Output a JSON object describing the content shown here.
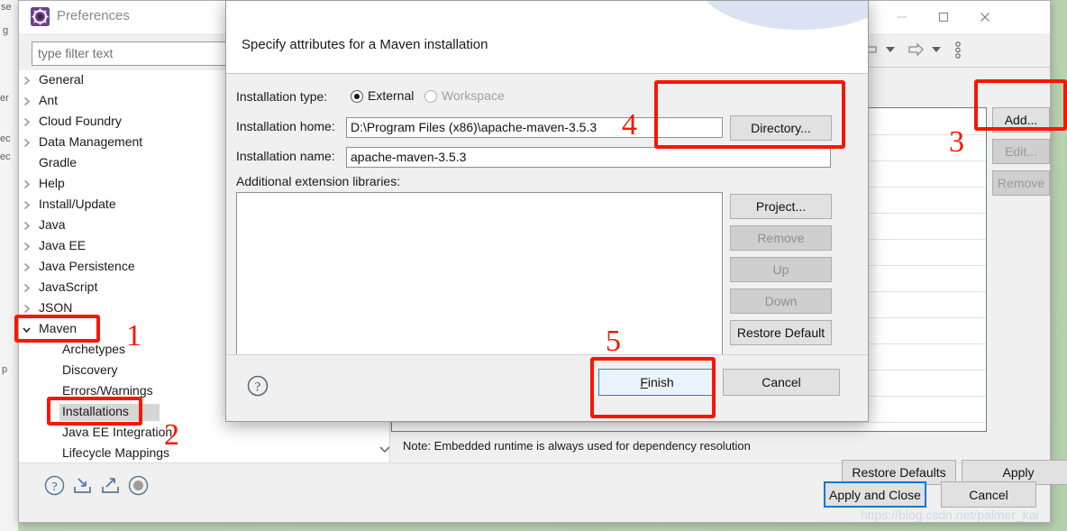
{
  "desktop": {
    "background_fragments": [
      "se",
      "g",
      "er",
      "ec",
      "ec",
      "p"
    ]
  },
  "preferences_window": {
    "title": "Preferences",
    "icon": "eclipse-preferences-icon",
    "window_controls": {
      "minimize": "minimize-icon",
      "maximize": "maximize-icon",
      "close": "close-icon"
    },
    "filter": {
      "placeholder": "type filter text",
      "value": ""
    },
    "tree": [
      {
        "label": "General",
        "indent": 0,
        "arrow": "collapsed",
        "selected": false
      },
      {
        "label": "Ant",
        "indent": 0,
        "arrow": "collapsed",
        "selected": false
      },
      {
        "label": "Cloud Foundry",
        "indent": 0,
        "arrow": "collapsed",
        "selected": false
      },
      {
        "label": "Data Management",
        "indent": 0,
        "arrow": "collapsed",
        "selected": false
      },
      {
        "label": "Gradle",
        "indent": 0,
        "arrow": "none",
        "selected": false
      },
      {
        "label": "Help",
        "indent": 0,
        "arrow": "collapsed",
        "selected": false
      },
      {
        "label": "Install/Update",
        "indent": 0,
        "arrow": "collapsed",
        "selected": false
      },
      {
        "label": "Java",
        "indent": 0,
        "arrow": "collapsed",
        "selected": false
      },
      {
        "label": "Java EE",
        "indent": 0,
        "arrow": "collapsed",
        "selected": false
      },
      {
        "label": "Java Persistence",
        "indent": 0,
        "arrow": "collapsed",
        "selected": false
      },
      {
        "label": "JavaScript",
        "indent": 0,
        "arrow": "collapsed",
        "selected": false
      },
      {
        "label": "JSON",
        "indent": 0,
        "arrow": "collapsed",
        "selected": false
      },
      {
        "label": "Maven",
        "indent": 0,
        "arrow": "expanded",
        "selected": false
      },
      {
        "label": "Archetypes",
        "indent": 1,
        "arrow": "none",
        "selected": false
      },
      {
        "label": "Discovery",
        "indent": 1,
        "arrow": "none",
        "selected": false
      },
      {
        "label": "Errors/Warnings",
        "indent": 1,
        "arrow": "none",
        "selected": false
      },
      {
        "label": "Installations",
        "indent": 1,
        "arrow": "none",
        "selected": true
      },
      {
        "label": "Java EE Integration",
        "indent": 1,
        "arrow": "none",
        "selected": false
      },
      {
        "label": "Lifecycle Mappings",
        "indent": 1,
        "arrow": "none",
        "selected": false
      }
    ],
    "tree_scroll_down": "chevron-down-icon",
    "footer_icons": [
      "help-icon",
      "import-preferences-icon",
      "export-preferences-icon",
      "record-icon"
    ],
    "nav_icons": [
      "back-arrow-icon",
      "back-dropdown-icon",
      "forward-arrow-icon",
      "forward-dropdown-icon",
      "view-menu-icon"
    ],
    "side_buttons": [
      {
        "label": "Add...",
        "enabled": true
      },
      {
        "label": "Edit...",
        "enabled": false
      },
      {
        "label": "Remove",
        "enabled": false
      }
    ],
    "note": "Note: Embedded runtime is always used for dependency resolution",
    "page_buttons": [
      {
        "label": "Restore Defaults",
        "enabled": true
      },
      {
        "label": "Apply",
        "enabled": true
      }
    ],
    "apply_and_close": "Apply and Close",
    "cancel": "Cancel"
  },
  "dialog": {
    "header": "Specify attributes for a Maven installation",
    "installation_type": {
      "label": "Installation type:",
      "options": [
        {
          "label": "External",
          "selected": true,
          "enabled": true
        },
        {
          "label": "Workspace",
          "selected": false,
          "enabled": false
        }
      ]
    },
    "installation_home": {
      "label": "Installation home:",
      "value": "D:\\Program Files (x86)\\apache-maven-3.5.3",
      "browse_button": "Directory..."
    },
    "installation_name": {
      "label": "Installation name:",
      "value": "apache-maven-3.5.3"
    },
    "extension_libraries": {
      "label": "Additional extension libraries:",
      "items": [],
      "buttons": [
        {
          "label": "Project...",
          "enabled": true
        },
        {
          "label": "Remove",
          "enabled": false
        },
        {
          "label": "Up",
          "enabled": false
        },
        {
          "label": "Down",
          "enabled": false
        },
        {
          "label": "Restore Default",
          "enabled": true
        }
      ]
    },
    "footer": {
      "help_icon": "help-icon",
      "finish": "Finish",
      "cancel": "Cancel"
    }
  },
  "annotations": {
    "color": "#fb1500",
    "numbers": [
      "1",
      "2",
      "3",
      "4",
      "5"
    ]
  },
  "watermark": "https://blog.csdn.net/palmer_kai"
}
